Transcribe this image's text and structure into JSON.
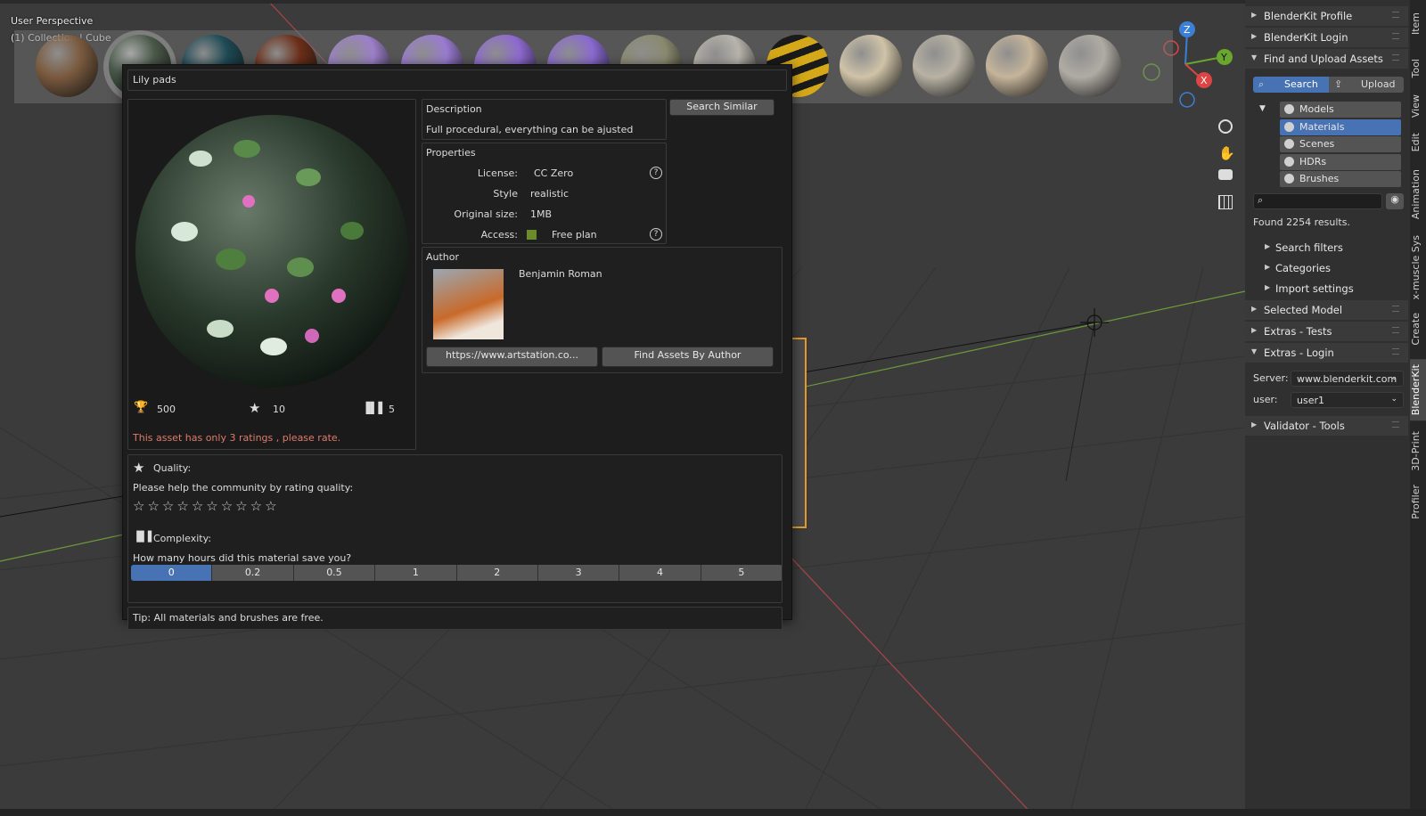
{
  "viewport": {
    "perspective_label": "User Perspective",
    "collection_label": "(1) Collection | Cube"
  },
  "thumbnails": [
    {
      "name": "wood",
      "color": "#7a5a3e"
    },
    {
      "name": "lily",
      "color": "#4a5a4a"
    },
    {
      "name": "teal",
      "color": "#1e4a55"
    },
    {
      "name": "copper",
      "color": "#6b2e18"
    },
    {
      "name": "purple-1",
      "color": "#9c80c8"
    },
    {
      "name": "purple-2",
      "color": "#9a7bd0"
    },
    {
      "name": "purple-3",
      "color": "#8e6ad0"
    },
    {
      "name": "purple-4",
      "color": "#8a6ad0"
    },
    {
      "name": "stone-1",
      "color": "#8a8a70"
    },
    {
      "name": "gravel",
      "color": "#b8b4ac"
    },
    {
      "name": "hazard",
      "color": "#c8a020"
    },
    {
      "name": "tile-1",
      "color": "#cfc3a8"
    },
    {
      "name": "tile-2",
      "color": "#b8b2a4"
    },
    {
      "name": "tile-3",
      "color": "#c4b49a"
    },
    {
      "name": "tile-4",
      "color": "#b0aca4"
    }
  ],
  "popup": {
    "title": "Lily pads",
    "description_label": "Description",
    "description_text": "Full procedural, everything can be ajusted",
    "search_similar": "Search Similar",
    "properties_label": "Properties",
    "props": [
      {
        "key": "License:",
        "value": "CC Zero"
      },
      {
        "key": "Style",
        "value": "realistic"
      },
      {
        "key": "Original size:",
        "value": "1MB"
      },
      {
        "key": "Access:",
        "value": "Free plan"
      }
    ],
    "author_label": "Author",
    "author_name": "Benjamin Roman",
    "author_url": "https://www.artstation.co...",
    "find_by_author": "Find Assets By Author",
    "stat_downloads": "500",
    "stat_stars": "10",
    "stat_complexity": "5",
    "rating_warning": "This asset has only 3 ratings , please rate.",
    "quality_label": "Quality:",
    "quality_prompt": "Please help the community by rating quality:",
    "complexity_label": "Complexity:",
    "complexity_prompt": "How many hours did this material save you?",
    "hours": [
      "0",
      "0.2",
      "0.5",
      "1",
      "2",
      "3",
      "4",
      "5"
    ],
    "hours_selected": 0,
    "tip": "Tip: All materials and brushes are free.",
    "access_color": "#6b8a2a"
  },
  "sidebar": {
    "profile": "BlenderKit Profile",
    "login": "BlenderKit Login",
    "find_upload": "Find and Upload Assets",
    "search_tab": "Search",
    "upload_tab": "Upload",
    "categories": [
      "Models",
      "Materials",
      "Scenes",
      "HDRs",
      "Brushes"
    ],
    "categories_selected": 1,
    "search_placeholder": "",
    "results": "Found 2254 results.",
    "search_filters": "Search filters",
    "categories_label": "Categories",
    "import_settings": "Import settings",
    "selected_model": "Selected Model",
    "extras_tests": "Extras - Tests",
    "extras_login": "Extras - Login",
    "server_label": "Server:",
    "server_value": "www.blenderkit.com",
    "user_label": "user:",
    "user_value": "user1",
    "validator": "Validator - Tools",
    "accent": "#4772b3"
  },
  "tabs": [
    "Item",
    "Tool",
    "View",
    "Edit",
    "Animation",
    "x-muscle Sys",
    "Create",
    "BlenderKit",
    "3D-Print",
    "Profiler"
  ],
  "tabs_active": 7
}
